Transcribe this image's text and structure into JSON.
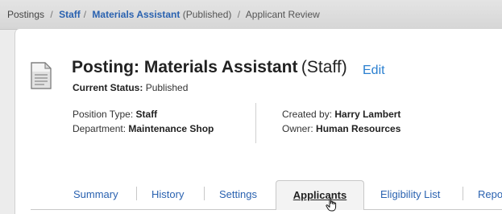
{
  "breadcrumb": {
    "postings": "Postings",
    "sep1": "/",
    "staff": "Staff",
    "sep2": "/",
    "posting": "Materials Assistant",
    "published": "(Published)",
    "sep3": "/",
    "current": "Applicant Review"
  },
  "posting": {
    "title": "Posting: Materials Assistant",
    "type_suffix": "(Staff)",
    "edit_label": "Edit",
    "status_label": "Current Status:",
    "status_value": "Published"
  },
  "details": {
    "position_type_label": "Position Type:",
    "position_type_value": "Staff",
    "department_label": "Department:",
    "department_value": "Maintenance Shop",
    "created_by_label": "Created by:",
    "created_by_value": "Harry Lambert",
    "owner_label": "Owner:",
    "owner_value": "Human Resources"
  },
  "tabs": [
    {
      "label": "Summary"
    },
    {
      "label": "History"
    },
    {
      "label": "Settings"
    },
    {
      "label": "Applicants",
      "active": true
    },
    {
      "label": "Eligibility List"
    },
    {
      "label": "Repo"
    }
  ],
  "icons": {
    "document": "document-icon",
    "cursor": "hand-pointer-icon"
  },
  "colors": {
    "link": "#2a62b0",
    "edit": "#2a7fd0",
    "breadcrumb_bg": "#d9d9d9"
  }
}
